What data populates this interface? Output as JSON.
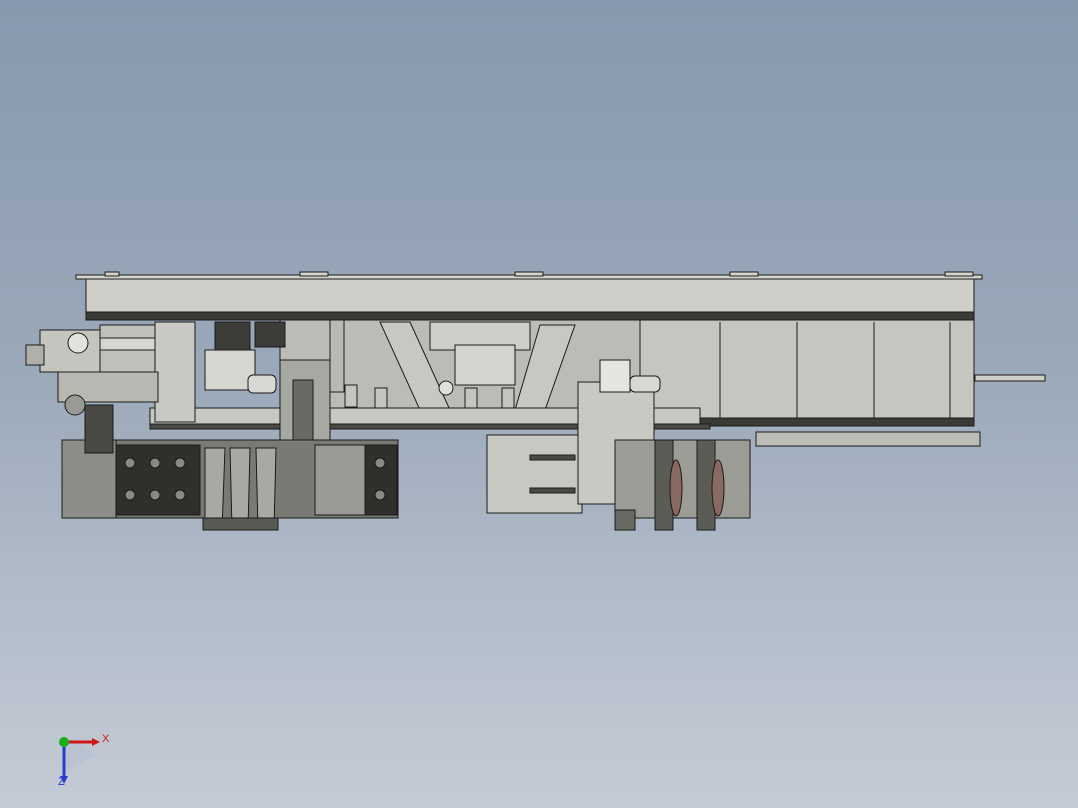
{
  "viewport": {
    "background_top": "#8799ae",
    "background_bottom": "#c4cbd6"
  },
  "triad": {
    "x_label": "X",
    "z_label": "Z",
    "x_color": "#d01818",
    "y_color": "#18b018",
    "z_color": "#2a3ad0"
  },
  "model": {
    "part_fill": "#c9c9c4",
    "part_dark": "#55554f",
    "edge_color": "#1a1a1a"
  }
}
